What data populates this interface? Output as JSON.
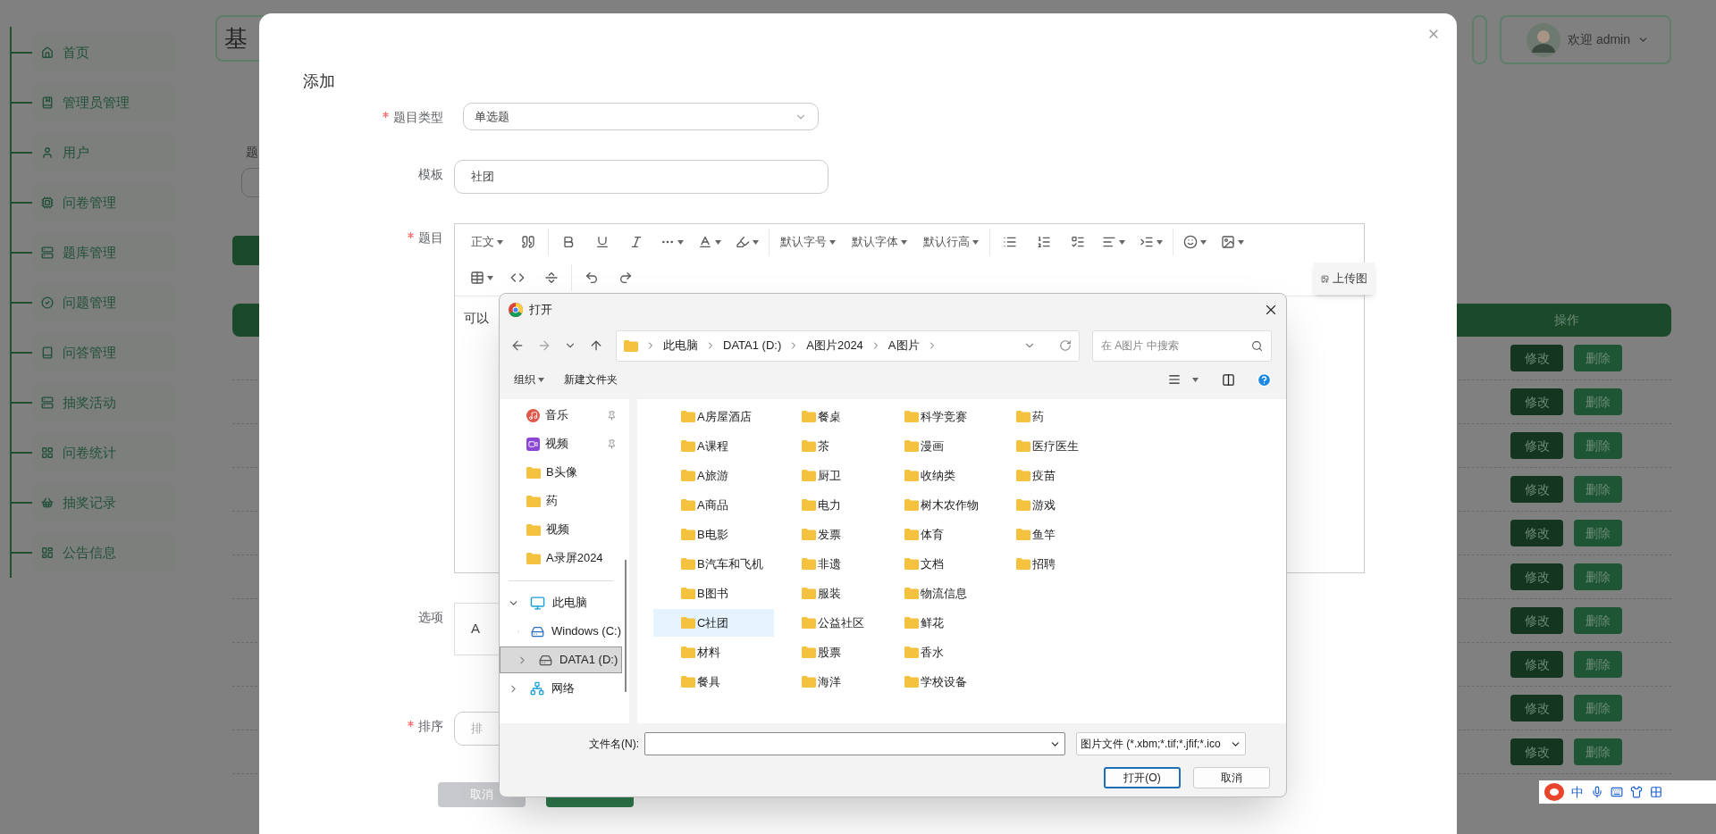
{
  "sidebar": {
    "items": [
      {
        "label": "首页",
        "kind": "home"
      },
      {
        "label": "管理员管理",
        "kind": "bookmark"
      },
      {
        "label": "用户",
        "kind": "user"
      },
      {
        "label": "问卷管理",
        "kind": "chip"
      },
      {
        "label": "题库管理",
        "kind": "server"
      },
      {
        "label": "问题管理",
        "kind": "check"
      },
      {
        "label": "问答管理",
        "kind": "book"
      },
      {
        "label": "抽奖活动",
        "kind": "server"
      },
      {
        "label": "问卷统计",
        "kind": "grid"
      },
      {
        "label": "抽奖记录",
        "kind": "basket"
      },
      {
        "label": "公告信息",
        "kind": "dashboard"
      }
    ]
  },
  "header": {
    "title": "基",
    "user": {
      "greeting": "欢迎 admin"
    }
  },
  "background": {
    "search_label": "题",
    "table": {
      "action_header": "操作",
      "rows": [
        {
          "edit": "修改",
          "delete": "删除"
        },
        {
          "edit": "修改",
          "delete": "删除"
        },
        {
          "edit": "修改",
          "delete": "删除"
        },
        {
          "edit": "修改",
          "delete": "删除"
        },
        {
          "edit": "修改",
          "delete": "删除"
        },
        {
          "edit": "修改",
          "delete": "删除"
        },
        {
          "edit": "修改",
          "delete": "删除"
        },
        {
          "edit": "修改",
          "delete": "删除"
        },
        {
          "edit": "修改",
          "delete": "删除"
        },
        {
          "edit": "修改",
          "delete": "删除"
        }
      ]
    }
  },
  "modal": {
    "title": "添加",
    "fields": [
      {
        "kind": "select",
        "label": "题目类型",
        "required": true,
        "value": "单选题"
      },
      {
        "kind": "input",
        "label": "模板",
        "required": false,
        "value": "社团"
      },
      {
        "kind": "editor",
        "label": "题目",
        "required": true
      },
      {
        "kind": "option",
        "label": "选项",
        "required": false,
        "value": "A"
      },
      {
        "kind": "input",
        "label": "排序",
        "required": true,
        "placeholder": "排"
      }
    ],
    "buttons": [
      {
        "kind": "cancel",
        "label": "取消"
      },
      {
        "kind": "primary"
      }
    ]
  },
  "editor": {
    "toolbar": [
      [
        [
          {
            "kind": "text",
            "label": "正文",
            "dropdown": true
          },
          {
            "kind": "quote",
            "dropdown": false
          }
        ],
        [
          {
            "kind": "bold",
            "dropdown": false
          },
          {
            "kind": "underline",
            "dropdown": false
          },
          {
            "kind": "italic",
            "dropdown": false
          },
          {
            "kind": "more",
            "dropdown": true
          },
          {
            "kind": "font-color",
            "dropdown": true
          },
          {
            "kind": "bg-color",
            "dropdown": true
          }
        ],
        [
          {
            "kind": "text",
            "label": "默认字号",
            "dropdown": true
          },
          {
            "kind": "text",
            "label": "默认字体",
            "dropdown": true
          },
          {
            "kind": "text",
            "label": "默认行高",
            "dropdown": true
          }
        ],
        [
          {
            "kind": "bullet-list",
            "dropdown": false
          },
          {
            "kind": "numbered-list",
            "dropdown": false
          },
          {
            "kind": "todo",
            "dropdown": false
          },
          {
            "kind": "align",
            "dropdown": true
          },
          {
            "kind": "indent",
            "dropdown": true
          }
        ],
        [
          {
            "kind": "emoji",
            "dropdown": true
          },
          {
            "kind": "image",
            "dropdown": true
          }
        ]
      ],
      [
        [
          {
            "kind": "table",
            "dropdown": true
          },
          {
            "kind": "code",
            "dropdown": false
          },
          {
            "kind": "divider",
            "dropdown": false
          }
        ],
        [
          {
            "kind": "undo",
            "dropdown": false
          },
          {
            "kind": "redo",
            "dropdown": false
          }
        ]
      ]
    ],
    "content": "可以",
    "image_menu": "上传图"
  },
  "file_dialog": {
    "title": "打开",
    "path": [
      "此电脑",
      "DATA1 (D:)",
      "A图片2024",
      "A图片"
    ],
    "search_placeholder": "在 A图片 中搜索",
    "commands": [
      {
        "label": "组织",
        "dropdown": true
      },
      {
        "label": "新建文件夹",
        "dropdown": false
      }
    ],
    "quick_access": [
      {
        "label": "音乐",
        "kind": "music",
        "pinned": true
      },
      {
        "label": "视频",
        "kind": "video",
        "pinned": true
      },
      {
        "label": "B头像",
        "kind": "folder",
        "pinned": false
      },
      {
        "label": "药",
        "kind": "folder",
        "pinned": false
      },
      {
        "label": "视频",
        "kind": "folder",
        "pinned": false
      },
      {
        "label": "A录屏2024",
        "kind": "folder",
        "pinned": false
      }
    ],
    "tree": [
      {
        "label": "此电脑",
        "kind": "pc",
        "expanded": true,
        "selected": false,
        "children": [
          {
            "label": "Windows (C:)",
            "kind": "windows-drive",
            "expanded": false,
            "selected": false
          },
          {
            "label": "DATA1 (D:)",
            "kind": "drive",
            "expanded": false,
            "selected": true
          }
        ]
      },
      {
        "label": "网络",
        "kind": "network",
        "expanded": false,
        "selected": false
      }
    ],
    "folders": [
      {
        "label": "A房屋酒店",
        "hovered": false
      },
      {
        "label": "A课程",
        "hovered": false
      },
      {
        "label": "A旅游",
        "hovered": false
      },
      {
        "label": "A商品",
        "hovered": false
      },
      {
        "label": "B电影",
        "hovered": false
      },
      {
        "label": "B汽车和飞机",
        "hovered": false
      },
      {
        "label": "B图书",
        "hovered": false
      },
      {
        "label": "C社团",
        "hovered": true
      },
      {
        "label": "材料",
        "hovered": false
      },
      {
        "label": "餐具",
        "hovered": false
      },
      {
        "label": "餐桌",
        "hovered": false
      },
      {
        "label": "茶",
        "hovered": false
      },
      {
        "label": "厨卫",
        "hovered": false
      },
      {
        "label": "电力",
        "hovered": false
      },
      {
        "label": "发票",
        "hovered": false
      },
      {
        "label": "非遗",
        "hovered": false
      },
      {
        "label": "服装",
        "hovered": false
      },
      {
        "label": "公益社区",
        "hovered": false
      },
      {
        "label": "股票",
        "hovered": false
      },
      {
        "label": "海洋",
        "hovered": false
      },
      {
        "label": "科学竞赛",
        "hovered": false
      },
      {
        "label": "漫画",
        "hovered": false
      },
      {
        "label": "收纳类",
        "hovered": false
      },
      {
        "label": "树木农作物",
        "hovered": false
      },
      {
        "label": "体育",
        "hovered": false
      },
      {
        "label": "文档",
        "hovered": false
      },
      {
        "label": "物流信息",
        "hovered": false
      },
      {
        "label": "鲜花",
        "hovered": false
      },
      {
        "label": "香水",
        "hovered": false
      },
      {
        "label": "学校设备",
        "hovered": false
      },
      {
        "label": "药",
        "hovered": false
      },
      {
        "label": "医疗医生",
        "hovered": false
      },
      {
        "label": "疫苗",
        "hovered": false
      },
      {
        "label": "游戏",
        "hovered": false
      },
      {
        "label": "鱼竿",
        "hovered": false
      },
      {
        "label": "招聘",
        "hovered": false
      }
    ],
    "filename_label": "文件名(N):",
    "file_type": "图片文件 (*.xbm;*.tif;*.jfif;*.ico",
    "buttons": [
      {
        "label": "打开(O)",
        "default": true
      },
      {
        "label": "取消",
        "default": false
      }
    ]
  },
  "ime": {
    "mode": "中"
  }
}
